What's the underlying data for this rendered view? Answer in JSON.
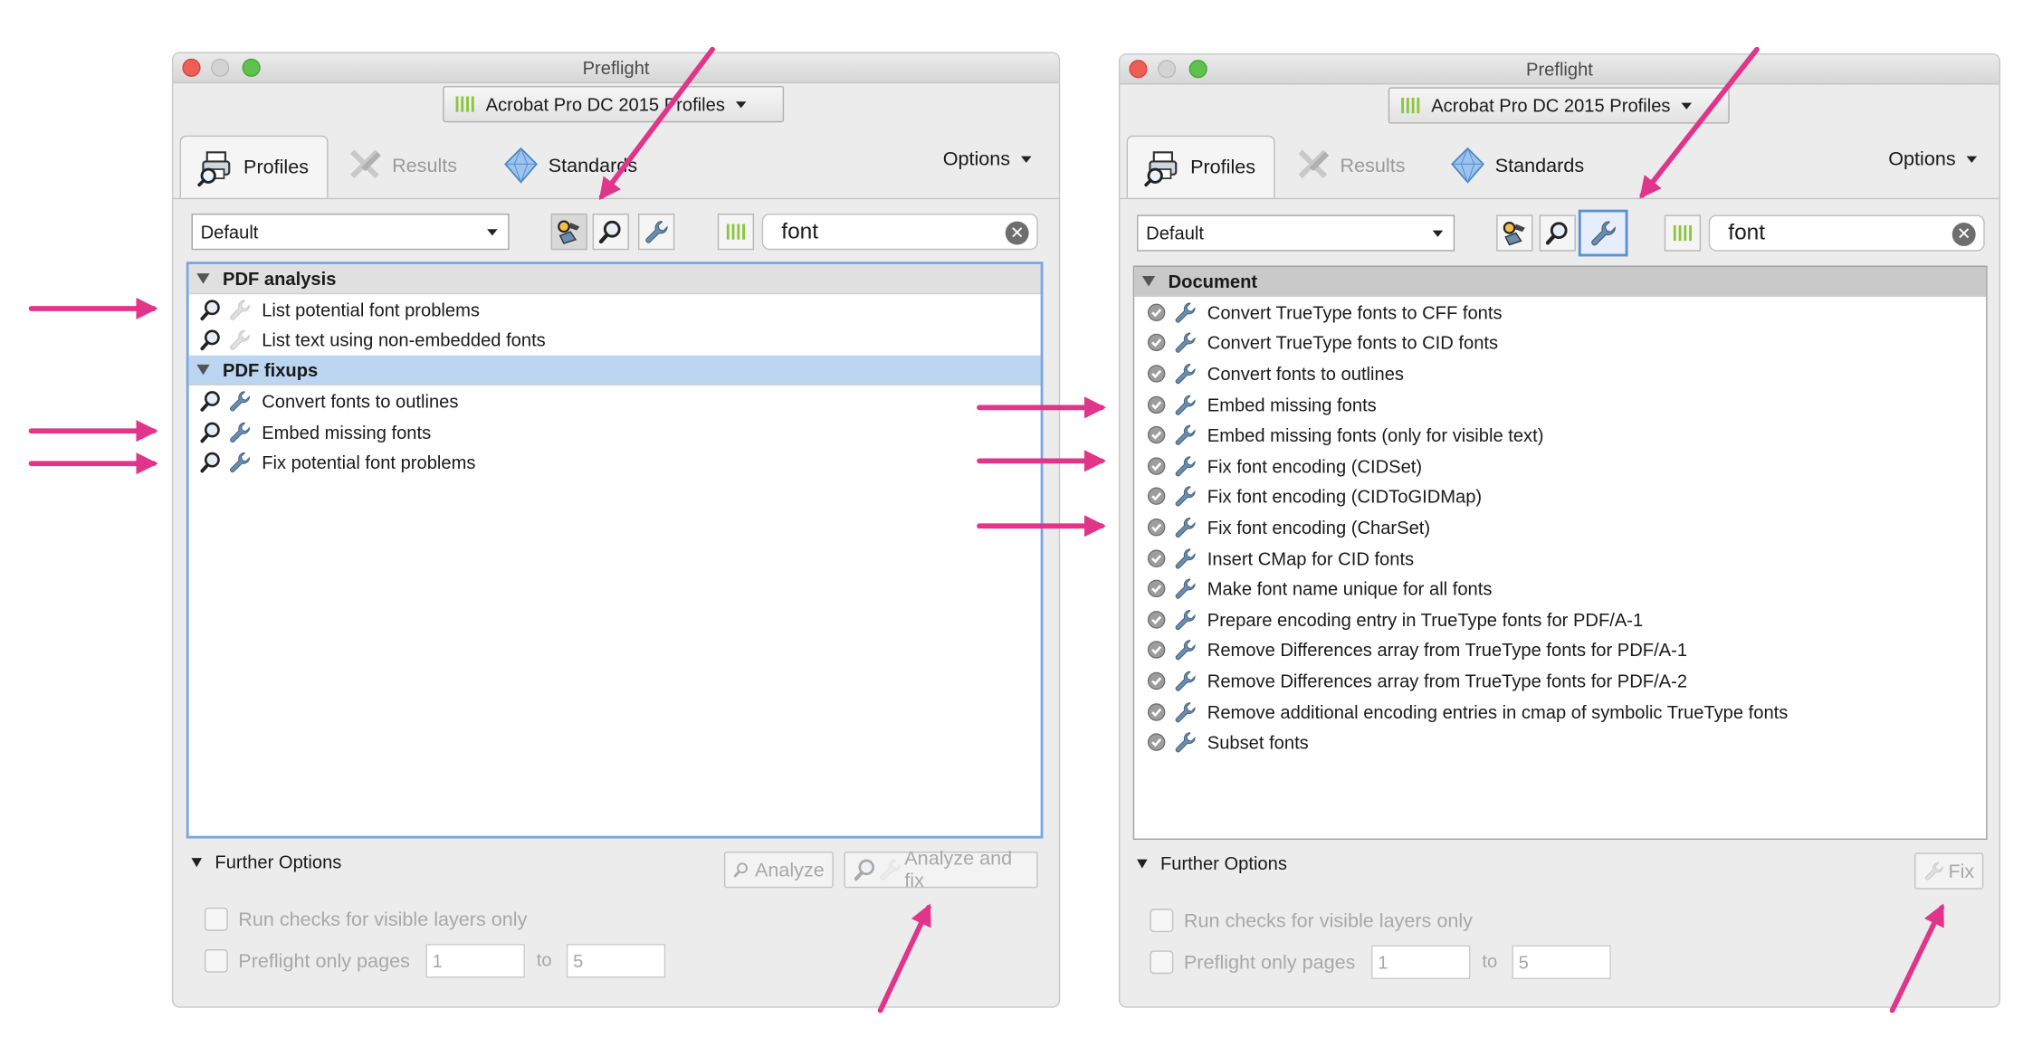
{
  "colors": {
    "annotation": "#e0358a",
    "list_selection": "#bcd5f0",
    "focus_ring": "#7aa7e3"
  },
  "icons": [
    "analyze-fix-icon",
    "magnifier-icon",
    "wrench-icon",
    "library-bars-icon",
    "clear-icon"
  ],
  "left_window": {
    "title": "Preflight",
    "profile_selector": "Acrobat Pro DC 2015 Profiles",
    "tabs": [
      "Profiles",
      "Results",
      "Standards"
    ],
    "options": "Options",
    "filter": "Default",
    "search": "font",
    "groups": [
      {
        "name": "PDF analysis",
        "items": [
          "List potential font problems",
          "List text using non-embedded fonts"
        ]
      },
      {
        "name": "PDF fixups",
        "items": [
          "Convert fonts to outlines",
          "Embed missing fonts",
          "Fix potential font problems"
        ]
      }
    ],
    "further_options": "Further Options",
    "analyze": "Analyze",
    "analyze_and_fix": "Analyze and fix",
    "visible_layers": "Run checks for visible layers only",
    "preflight_pages": "Preflight only pages",
    "page_from": "1",
    "page_to_label": "to",
    "page_to": "5"
  },
  "right_window": {
    "title": "Preflight",
    "profile_selector": "Acrobat Pro DC 2015 Profiles",
    "tabs": [
      "Profiles",
      "Results",
      "Standards"
    ],
    "options": "Options",
    "filter": "Default",
    "search": "font",
    "group": "Document",
    "items": [
      "Convert TrueType fonts to CFF fonts",
      "Convert TrueType fonts to CID fonts",
      "Convert fonts to outlines",
      "Embed missing fonts",
      "Embed missing fonts (only for visible text)",
      "Fix font encoding (CIDSet)",
      "Fix font encoding (CIDToGIDMap)",
      "Fix font encoding (CharSet)",
      "Insert CMap for CID fonts",
      "Make font name unique for all fonts",
      "Prepare encoding entry in TrueType fonts for PDF/A-1",
      "Remove Differences array from TrueType fonts for PDF/A-1",
      "Remove Differences array from TrueType fonts for PDF/A-2",
      "Remove additional encoding entries in cmap of symbolic TrueType fonts",
      "Subset fonts"
    ],
    "further_options": "Further Options",
    "fix": "Fix",
    "visible_layers": "Run checks for visible layers only",
    "preflight_pages": "Preflight only pages",
    "page_from": "1",
    "page_to_label": "to",
    "page_to": "5"
  }
}
